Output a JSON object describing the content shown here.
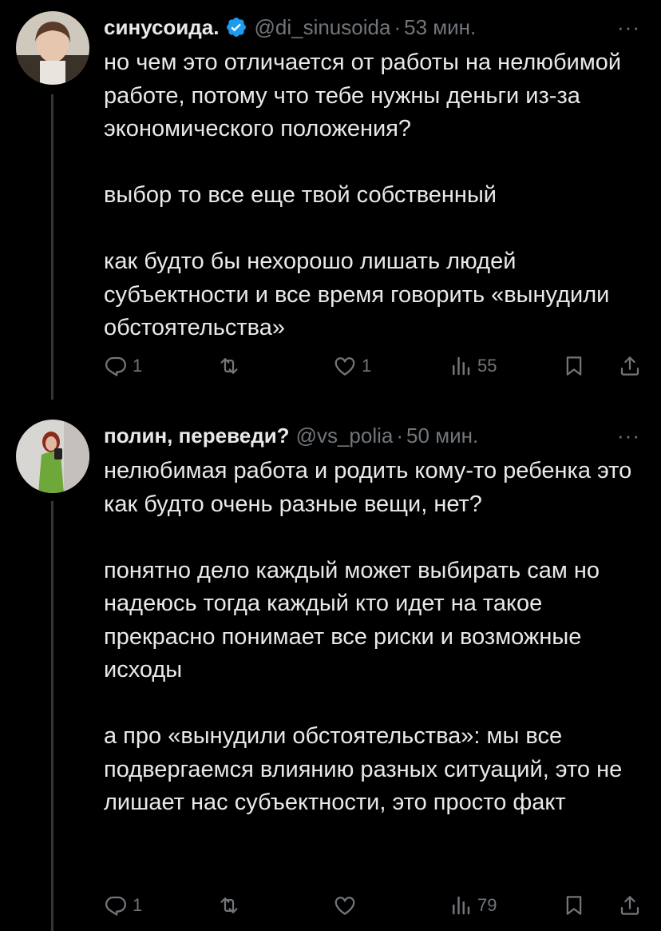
{
  "tweets": [
    {
      "name": "синусоида.",
      "verified": true,
      "handle": "@di_sinusoida",
      "separator": "·",
      "time": "53 мин.",
      "more": "···",
      "paragraphs": [
        "но чем это отличается от работы на нелюбимой работе, потому что тебе нужны деньги из-за экономического положения?",
        "выбор то все еще твой собственный",
        "как будто бы нехорошо лишать людей субъектности и все время говорить «вынудили обстоятельства»"
      ],
      "replies": "1",
      "retweets": "",
      "likes": "1",
      "views": "55"
    },
    {
      "name": "полин, переведи?",
      "verified": false,
      "handle": "@vs_polia",
      "separator": "·",
      "time": "50 мин.",
      "more": "···",
      "paragraphs": [
        "нелюбимая работа и родить кому-то ребенка это как будто очень разные вещи, нет?",
        "понятно дело каждый может выбирать сам но надеюсь тогда каждый кто идет на такое прекрасно понимает все риски и возможные исходы",
        "а про «вынудили обстоятельства»: мы все подвергаемся влиянию разных ситуаций, это не лишает нас субъектности, это просто факт"
      ],
      "replies": "1",
      "retweets": "",
      "likes": "",
      "views": "79"
    }
  ],
  "icons": {
    "reply": "reply-icon",
    "retweet": "retweet-icon",
    "like": "heart-icon",
    "views": "views-icon",
    "bookmark": "bookmark-icon",
    "share": "share-icon",
    "verified": "verified-badge-icon"
  },
  "colors": {
    "background": "#000000",
    "text": "#e7e9ea",
    "muted": "#71767b",
    "verified": "#1d9bf0",
    "thread_line": "#333639"
  }
}
